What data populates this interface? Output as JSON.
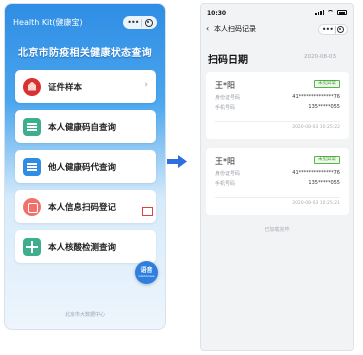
{
  "left_screen": {
    "app_title": "Health Kit(健康宝)",
    "headline": "北京市防疫相关健康状态查询",
    "menu_items": [
      {
        "label": "证件样本",
        "icon": "certificate-icon"
      },
      {
        "label": "本人健康码自查询",
        "icon": "health-card-icon"
      },
      {
        "label": "他人健康码代查询",
        "icon": "id-card-icon"
      },
      {
        "label": "本人信息扫码登记",
        "icon": "scan-icon"
      },
      {
        "label": "本人核酸检测查询",
        "icon": "medical-cross-icon"
      }
    ],
    "chevron": "›",
    "float_button": {
      "main": "语音",
      "sub": "Cantonese"
    },
    "footer": "北京市大数据中心"
  },
  "right_screen": {
    "status_time": "10:30",
    "nav_title": "本人扫码记录",
    "back_glyph": "‹",
    "section_title": "扫码日期",
    "section_date": "2020-08-03",
    "records": [
      {
        "name": "王*阳",
        "tag": "未见异常",
        "id_label": "身份证号码",
        "id_value": "41**************76",
        "phone_label": "手机号码",
        "phone_value": "135*****055",
        "timestamp": "2020-08-03 10:25:22"
      },
      {
        "name": "王*阳",
        "tag": "未见异常",
        "id_label": "身份证号码",
        "id_value": "41**************76",
        "phone_label": "手机号码",
        "phone_value": "135*****055",
        "timestamp": "2020-08-03 10:25:21"
      }
    ],
    "end_text": "已加载完毕"
  },
  "colors": {
    "primary_blue": "#2f8de4",
    "tag_green": "#3a9a2e",
    "highlight_red": "#e04040"
  }
}
